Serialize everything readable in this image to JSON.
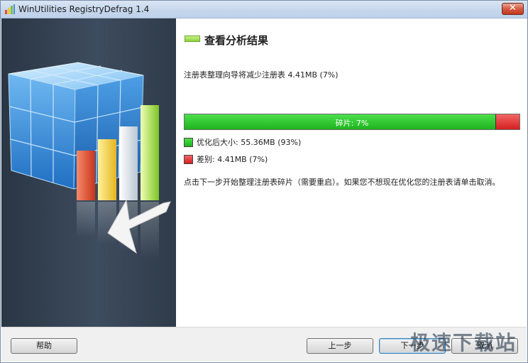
{
  "window": {
    "title": "WinUtilities RegistryDefrag 1.4",
    "close_label": "✕"
  },
  "page": {
    "title": "查看分析结果",
    "summary": "注册表整理向导将减少注册表 4.41MB (7%)"
  },
  "result_bar": {
    "label": "碎片: 7%",
    "optimized_fraction": 0.93,
    "fragment_fraction": 0.07,
    "green_color": "#1eb41e",
    "red_color": "#d42020"
  },
  "legend": {
    "optimized": "优化后大小: 55.36MB (93%)",
    "difference": "差别: 4.41MB (7%)"
  },
  "note": "点击下一步开始整理注册表碎片（需要重启）。如果您不想现在优化您的注册表请单击取消。",
  "buttons": {
    "help": "帮助",
    "back": "上一步",
    "next": "下一步",
    "cancel": "取消"
  },
  "watermark": "极速下载站",
  "icons": {
    "app": "app-icon",
    "close": "close-icon",
    "title_marker": "green-bar-icon"
  }
}
